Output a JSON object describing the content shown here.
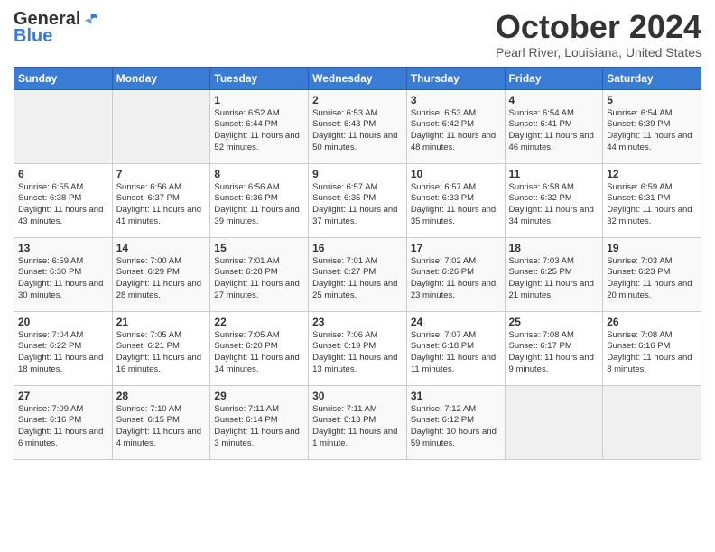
{
  "header": {
    "logo_general": "General",
    "logo_blue": "Blue",
    "month_title": "October 2024",
    "location": "Pearl River, Louisiana, United States"
  },
  "days_of_week": [
    "Sunday",
    "Monday",
    "Tuesday",
    "Wednesday",
    "Thursday",
    "Friday",
    "Saturday"
  ],
  "weeks": [
    [
      {
        "day": "",
        "empty": true
      },
      {
        "day": "",
        "empty": true
      },
      {
        "day": "1",
        "sunrise": "6:52 AM",
        "sunset": "6:44 PM",
        "daylight": "11 hours and 52 minutes."
      },
      {
        "day": "2",
        "sunrise": "6:53 AM",
        "sunset": "6:43 PM",
        "daylight": "11 hours and 50 minutes."
      },
      {
        "day": "3",
        "sunrise": "6:53 AM",
        "sunset": "6:42 PM",
        "daylight": "11 hours and 48 minutes."
      },
      {
        "day": "4",
        "sunrise": "6:54 AM",
        "sunset": "6:41 PM",
        "daylight": "11 hours and 46 minutes."
      },
      {
        "day": "5",
        "sunrise": "6:54 AM",
        "sunset": "6:39 PM",
        "daylight": "11 hours and 44 minutes."
      }
    ],
    [
      {
        "day": "6",
        "sunrise": "6:55 AM",
        "sunset": "6:38 PM",
        "daylight": "11 hours and 43 minutes."
      },
      {
        "day": "7",
        "sunrise": "6:56 AM",
        "sunset": "6:37 PM",
        "daylight": "11 hours and 41 minutes."
      },
      {
        "day": "8",
        "sunrise": "6:56 AM",
        "sunset": "6:36 PM",
        "daylight": "11 hours and 39 minutes."
      },
      {
        "day": "9",
        "sunrise": "6:57 AM",
        "sunset": "6:35 PM",
        "daylight": "11 hours and 37 minutes."
      },
      {
        "day": "10",
        "sunrise": "6:57 AM",
        "sunset": "6:33 PM",
        "daylight": "11 hours and 35 minutes."
      },
      {
        "day": "11",
        "sunrise": "6:58 AM",
        "sunset": "6:32 PM",
        "daylight": "11 hours and 34 minutes."
      },
      {
        "day": "12",
        "sunrise": "6:59 AM",
        "sunset": "6:31 PM",
        "daylight": "11 hours and 32 minutes."
      }
    ],
    [
      {
        "day": "13",
        "sunrise": "6:59 AM",
        "sunset": "6:30 PM",
        "daylight": "11 hours and 30 minutes."
      },
      {
        "day": "14",
        "sunrise": "7:00 AM",
        "sunset": "6:29 PM",
        "daylight": "11 hours and 28 minutes."
      },
      {
        "day": "15",
        "sunrise": "7:01 AM",
        "sunset": "6:28 PM",
        "daylight": "11 hours and 27 minutes."
      },
      {
        "day": "16",
        "sunrise": "7:01 AM",
        "sunset": "6:27 PM",
        "daylight": "11 hours and 25 minutes."
      },
      {
        "day": "17",
        "sunrise": "7:02 AM",
        "sunset": "6:26 PM",
        "daylight": "11 hours and 23 minutes."
      },
      {
        "day": "18",
        "sunrise": "7:03 AM",
        "sunset": "6:25 PM",
        "daylight": "11 hours and 21 minutes."
      },
      {
        "day": "19",
        "sunrise": "7:03 AM",
        "sunset": "6:23 PM",
        "daylight": "11 hours and 20 minutes."
      }
    ],
    [
      {
        "day": "20",
        "sunrise": "7:04 AM",
        "sunset": "6:22 PM",
        "daylight": "11 hours and 18 minutes."
      },
      {
        "day": "21",
        "sunrise": "7:05 AM",
        "sunset": "6:21 PM",
        "daylight": "11 hours and 16 minutes."
      },
      {
        "day": "22",
        "sunrise": "7:05 AM",
        "sunset": "6:20 PM",
        "daylight": "11 hours and 14 minutes."
      },
      {
        "day": "23",
        "sunrise": "7:06 AM",
        "sunset": "6:19 PM",
        "daylight": "11 hours and 13 minutes."
      },
      {
        "day": "24",
        "sunrise": "7:07 AM",
        "sunset": "6:18 PM",
        "daylight": "11 hours and 11 minutes."
      },
      {
        "day": "25",
        "sunrise": "7:08 AM",
        "sunset": "6:17 PM",
        "daylight": "11 hours and 9 minutes."
      },
      {
        "day": "26",
        "sunrise": "7:08 AM",
        "sunset": "6:16 PM",
        "daylight": "11 hours and 8 minutes."
      }
    ],
    [
      {
        "day": "27",
        "sunrise": "7:09 AM",
        "sunset": "6:16 PM",
        "daylight": "11 hours and 6 minutes."
      },
      {
        "day": "28",
        "sunrise": "7:10 AM",
        "sunset": "6:15 PM",
        "daylight": "11 hours and 4 minutes."
      },
      {
        "day": "29",
        "sunrise": "7:11 AM",
        "sunset": "6:14 PM",
        "daylight": "11 hours and 3 minutes."
      },
      {
        "day": "30",
        "sunrise": "7:11 AM",
        "sunset": "6:13 PM",
        "daylight": "11 hours and 1 minute."
      },
      {
        "day": "31",
        "sunrise": "7:12 AM",
        "sunset": "6:12 PM",
        "daylight": "10 hours and 59 minutes."
      },
      {
        "day": "",
        "empty": true
      },
      {
        "day": "",
        "empty": true
      }
    ]
  ]
}
